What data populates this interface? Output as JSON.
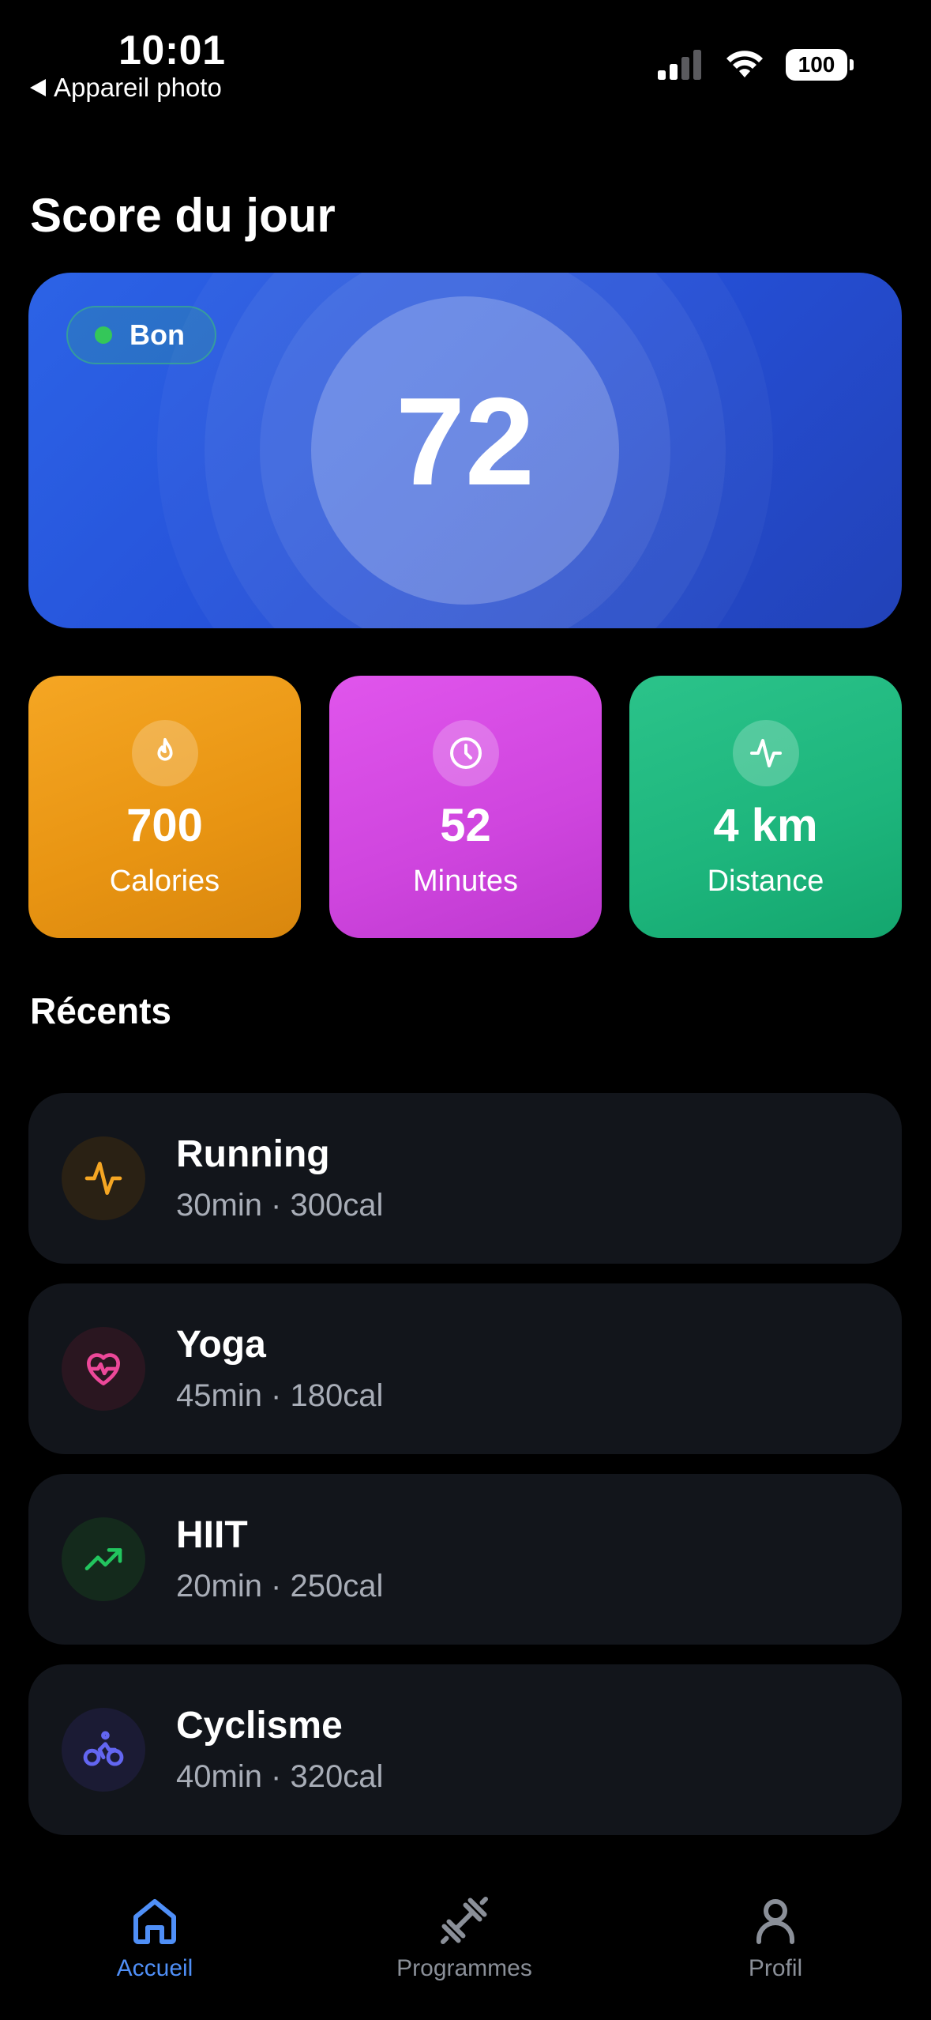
{
  "status_bar": {
    "time": "10:01",
    "back_label": "Appareil photo",
    "battery": "100"
  },
  "page_title": "Score du jour",
  "score": {
    "value": "72",
    "badge": "Bon",
    "badge_color": "#34c759",
    "card_color": "#2a5ae0"
  },
  "stats": [
    {
      "value": "700",
      "label": "Calories",
      "icon": "flame-icon",
      "color": "#f0a01c"
    },
    {
      "value": "52",
      "label": "Minutes",
      "icon": "clock-icon",
      "color": "#d84de6"
    },
    {
      "value": "4 km",
      "label": "Distance",
      "icon": "activity-icon",
      "color": "#22bb82"
    }
  ],
  "recents_title": "Récents",
  "recents": [
    {
      "name": "Running",
      "meta": "30min · 300cal",
      "icon": "activity-icon",
      "color": "#f5a623"
    },
    {
      "name": "Yoga",
      "meta": "45min · 180cal",
      "icon": "heart-pulse-icon",
      "color": "#ec4899"
    },
    {
      "name": "HIIT",
      "meta": "20min · 250cal",
      "icon": "trending-up-icon",
      "color": "#22c55e"
    },
    {
      "name": "Cyclisme",
      "meta": "40min · 320cal",
      "icon": "bike-icon",
      "color": "#6366f1"
    }
  ],
  "tabs": [
    {
      "label": "Accueil",
      "icon": "home-icon",
      "active": true
    },
    {
      "label": "Programmes",
      "icon": "dumbbell-icon",
      "active": false
    },
    {
      "label": "Profil",
      "icon": "user-icon",
      "active": false
    }
  ],
  "colors": {
    "background": "#000000",
    "card": "#12151b",
    "accent": "#4f8ff7",
    "muted_text": "#8a8f98"
  }
}
